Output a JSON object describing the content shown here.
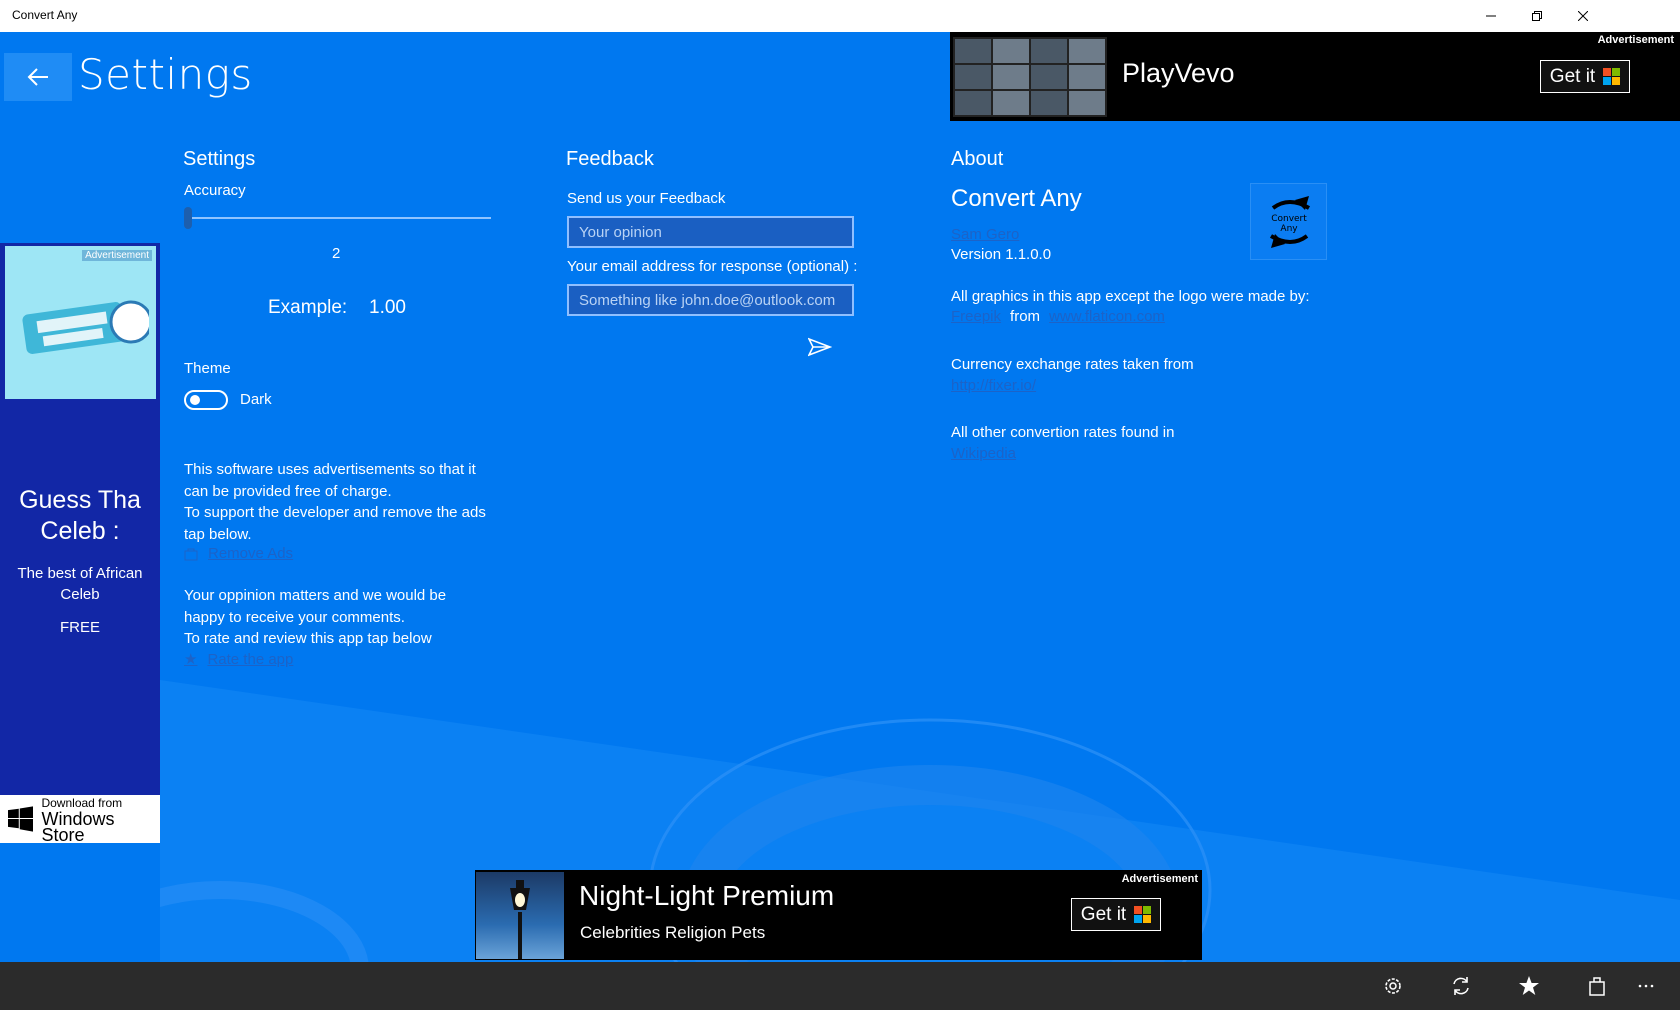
{
  "window": {
    "title": "Convert Any",
    "minimize_icon": "minimize-icon",
    "maximize_icon": "restore-icon",
    "close_icon": "close-icon"
  },
  "header": {
    "back_icon": "back-arrow-icon",
    "title": "Settings"
  },
  "settings": {
    "heading": "Settings",
    "accuracy_label": "Accuracy",
    "accuracy_value": "2",
    "accuracy_slider_fraction": 0.0,
    "example_label": "Example:",
    "example_value": "1.00",
    "theme_label": "Theme",
    "theme_toggle_text": "Dark",
    "theme_toggle_on": false,
    "ads_text_1": "This software uses advertisements so that it can be provided free of charge.",
    "ads_text_2": "To support the developer and remove the ads tap below.",
    "remove_ads_link": "Remove Ads",
    "rate_text_1": "Your oppinion matters and we would be happy to receive your comments.",
    "rate_text_2": "To rate and review this app tap below",
    "rate_link": "Rate the app"
  },
  "feedback": {
    "heading": "Feedback",
    "send_label": "Send us your Feedback",
    "opinion_placeholder": "Your opinion",
    "email_label": "Your email address for response (optional) :",
    "email_placeholder": "Something like john.doe@outlook.com",
    "send_icon": "send-icon"
  },
  "about": {
    "heading": "About",
    "app_name": "Convert Any",
    "author_link": "Sam Gero",
    "version": "Version 1.1.0.0",
    "logo_text": "Convert Any",
    "graphics_text": "All graphics in this app except the logo were made by:",
    "freepik_link": "Freepik",
    "from_text": "from",
    "flaticon_link": "www.flaticon.com",
    "currency_text": "Currency exchange rates taken from",
    "fixer_link": "http://fixer.io/",
    "other_text": "All other convertion rates found in",
    "wikipedia_link": "Wikipedia"
  },
  "left_ad": {
    "tag": "Advertisement",
    "name": "Guess Tha Celeb :",
    "desc": "The best of African Celeb",
    "price": "FREE",
    "store_small": "Download from",
    "store_big": "Windows Store"
  },
  "top_ad": {
    "tag": "Advertisement",
    "title": "PlayVevo",
    "cta": "Get it"
  },
  "bottom_ad": {
    "tag": "Advertisement",
    "title": "Night-Light Premium",
    "subtitle": "Celebrities Religion Pets",
    "cta": "Get it"
  },
  "appbar": {
    "icons": [
      "settings-icon",
      "refresh-icon",
      "star-icon",
      "store-icon",
      "more-icon"
    ]
  },
  "colors": {
    "background": "#0078f0",
    "link": "#1c63c8",
    "appbar": "#2b2b2b",
    "left_ad_bg": "#1227a6"
  }
}
